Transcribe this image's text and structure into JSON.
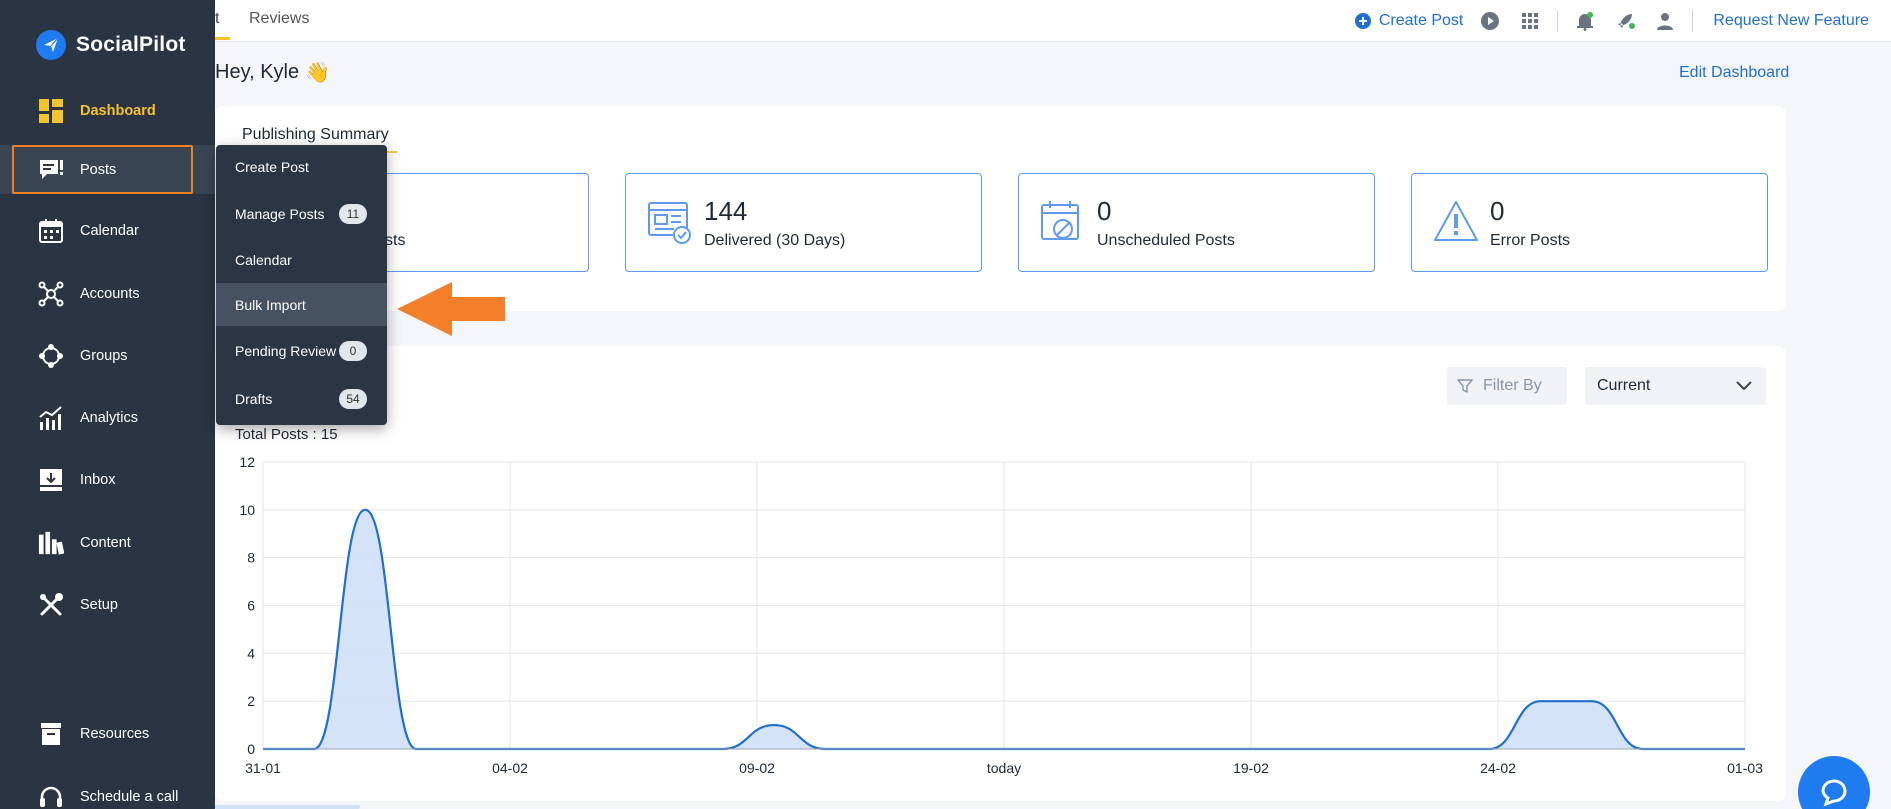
{
  "app": {
    "name": "SocialPilot"
  },
  "sidebar": {
    "items": [
      {
        "label": "Dashboard",
        "icon": "dashboard-icon"
      },
      {
        "label": "Posts",
        "icon": "posts-icon"
      },
      {
        "label": "Calendar",
        "icon": "calendar-icon"
      },
      {
        "label": "Accounts",
        "icon": "accounts-icon"
      },
      {
        "label": "Groups",
        "icon": "groups-icon"
      },
      {
        "label": "Analytics",
        "icon": "analytics-icon"
      },
      {
        "label": "Inbox",
        "icon": "inbox-icon"
      },
      {
        "label": "Content",
        "icon": "content-icon"
      },
      {
        "label": "Setup",
        "icon": "setup-icon"
      }
    ],
    "bottom_items": [
      {
        "label": "Resources",
        "icon": "resources-icon"
      },
      {
        "label": "Schedule a call",
        "icon": "headset-icon"
      }
    ]
  },
  "topbar": {
    "tab_partial": "t",
    "tab_reviews": "Reviews",
    "create_post": "Create Post",
    "request_feature": "Request New Feature"
  },
  "greeting": "Hey, Kyle",
  "greeting_emoji": "👋",
  "edit_dashboard": "Edit Dashboard",
  "summary": {
    "tab": "Publishing Summary",
    "partial_label": "sts",
    "stats": [
      {
        "value": "144",
        "label": "Delivered (30 Days)",
        "icon": "delivered-icon"
      },
      {
        "value": "0",
        "label": "Unscheduled Posts",
        "icon": "unscheduled-icon"
      },
      {
        "value": "0",
        "label": "Error Posts",
        "icon": "warning-icon"
      }
    ]
  },
  "posts_submenu": [
    {
      "label": "Create Post",
      "badge": ""
    },
    {
      "label": "Manage Posts",
      "badge": "11"
    },
    {
      "label": "Calendar",
      "badge": ""
    },
    {
      "label": "Bulk Import",
      "badge": ""
    },
    {
      "label": "Pending Review",
      "badge": "0"
    },
    {
      "label": "Drafts",
      "badge": "54"
    }
  ],
  "chart_controls": {
    "filter_label": "Filter By",
    "period_selected": "Current"
  },
  "total_posts": "Total Posts : 15",
  "colors": {
    "sidebar_bg": "#2a3442",
    "accent_yellow": "#f5c32c",
    "link_blue": "#1f6fd1",
    "highlight_orange": "#f08022",
    "chart_line": "#1f6fd1",
    "chart_fill": "#cfe0f7"
  },
  "chart_data": {
    "type": "area",
    "x_tick_labels": [
      "31-01",
      "04-02",
      "09-02",
      "today",
      "19-02",
      "24-02",
      "01-03"
    ],
    "ylim": [
      0,
      12
    ],
    "y_ticks": [
      0,
      2,
      4,
      6,
      8,
      10,
      12
    ],
    "grid": true,
    "series": [
      {
        "values": [
          [
            0,
            0
          ],
          [
            1,
            0
          ],
          [
            2,
            10
          ],
          [
            3,
            0
          ],
          [
            4,
            0
          ],
          [
            5,
            0
          ],
          [
            6,
            0
          ],
          [
            7,
            0
          ],
          [
            8,
            0
          ],
          [
            9,
            0
          ],
          [
            10,
            1
          ],
          [
            11,
            0
          ],
          [
            12,
            0
          ],
          [
            13,
            0
          ],
          [
            14,
            0
          ],
          [
            15,
            0
          ],
          [
            16,
            0
          ],
          [
            17,
            0
          ],
          [
            18,
            0
          ],
          [
            19,
            0
          ],
          [
            20,
            0
          ],
          [
            21,
            0
          ],
          [
            22,
            0
          ],
          [
            23,
            0
          ],
          [
            24,
            0
          ],
          [
            25,
            2
          ],
          [
            26,
            2
          ],
          [
            27,
            0
          ],
          [
            28,
            0
          ],
          [
            29,
            0
          ]
        ]
      }
    ]
  }
}
